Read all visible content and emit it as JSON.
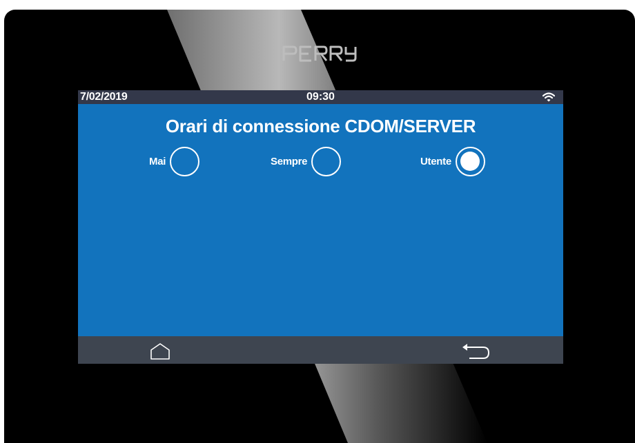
{
  "device": {
    "brand": "PERRY"
  },
  "status_bar": {
    "date": "7/02/2019",
    "time": "09:30",
    "wifi_icon": "wifi-icon"
  },
  "screen": {
    "title": "Orari di connessione CDOM/SERVER",
    "options": [
      {
        "label": "Mai",
        "selected": false
      },
      {
        "label": "Sempre",
        "selected": false
      },
      {
        "label": "Utente",
        "selected": true
      }
    ]
  },
  "nav_bar": {
    "home_icon": "home-icon",
    "back_icon": "back-arrow-icon"
  },
  "colors": {
    "screen_background": "#1273bd",
    "status_bar": "#33384a",
    "nav_bar": "#3e4550",
    "bezel": "#000000"
  }
}
